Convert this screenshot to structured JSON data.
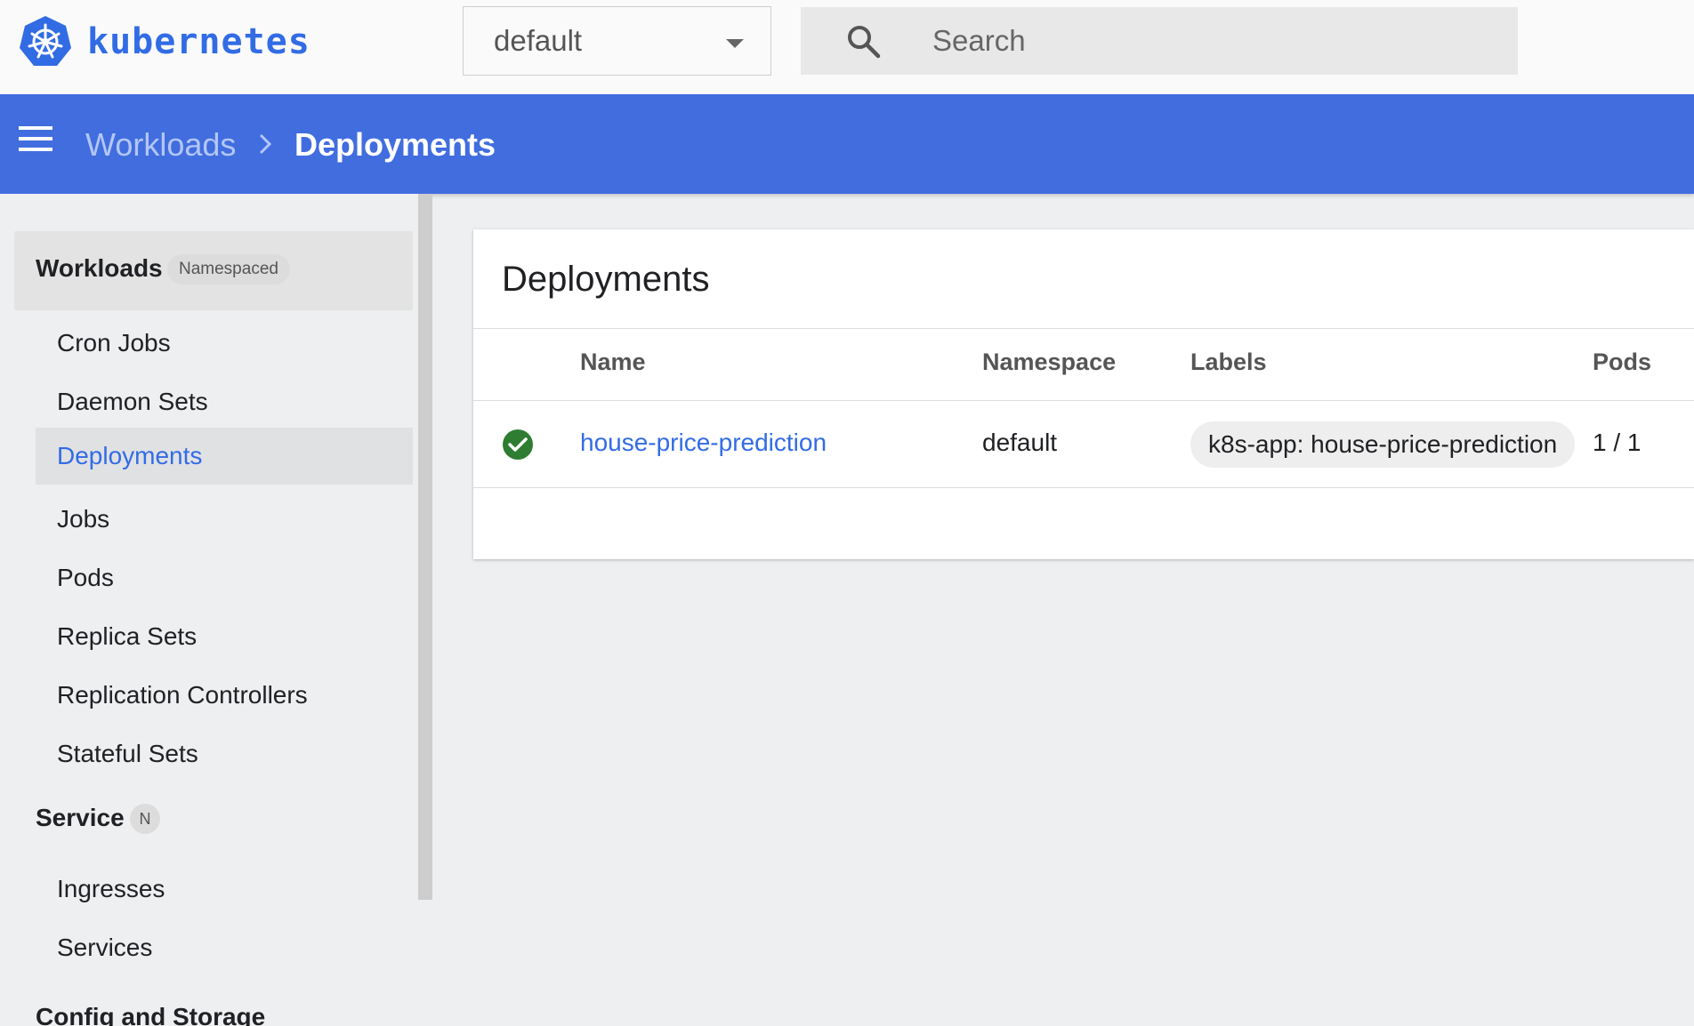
{
  "topbar": {
    "brand": "kubernetes",
    "namespace_selector": {
      "value": "default"
    },
    "search": {
      "placeholder": "Search"
    }
  },
  "appbar": {
    "breadcrumb": {
      "parent": "Workloads",
      "current": "Deployments"
    }
  },
  "sidebar": {
    "workloads": {
      "title": "Workloads",
      "badge": "Namespaced",
      "items": [
        {
          "label": "Cron Jobs"
        },
        {
          "label": "Daemon Sets"
        },
        {
          "label": "Deployments",
          "active": true
        },
        {
          "label": "Jobs"
        },
        {
          "label": "Pods"
        },
        {
          "label": "Replica Sets"
        },
        {
          "label": "Replication Controllers"
        },
        {
          "label": "Stateful Sets"
        }
      ]
    },
    "service": {
      "title": "Service",
      "badge": "N",
      "items": [
        {
          "label": "Ingresses"
        },
        {
          "label": "Services"
        }
      ]
    },
    "config": {
      "title": "Config and Storage"
    }
  },
  "main": {
    "card_title": "Deployments",
    "columns": [
      "Name",
      "Namespace",
      "Labels",
      "Pods"
    ],
    "rows": [
      {
        "status": "ok",
        "name": "house-price-prediction",
        "namespace": "default",
        "label": "k8s-app: house-price-prediction",
        "pods": "1 / 1"
      }
    ]
  },
  "colors": {
    "brand": "#326ce5",
    "appbar": "#416ddf",
    "status_ok": "#2e7d32"
  }
}
